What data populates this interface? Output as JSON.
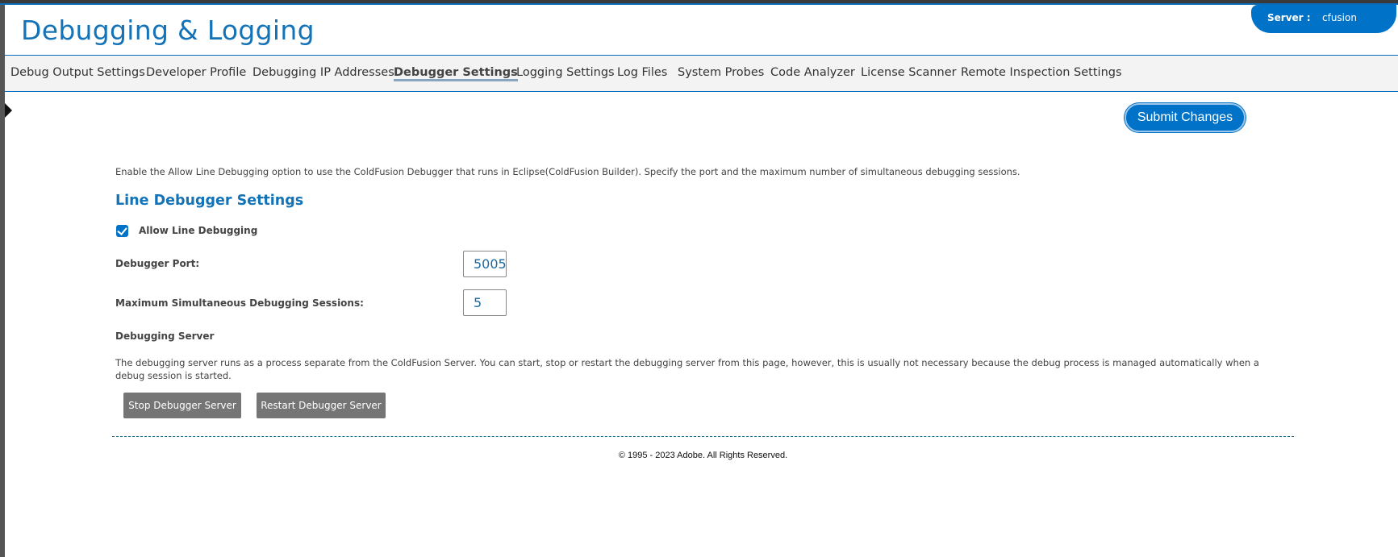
{
  "header": {
    "title": "Debugging & Logging",
    "server_label": "Server :",
    "server_value": "cfusion"
  },
  "nav": {
    "tabs": [
      {
        "label": "Debug Output Settings"
      },
      {
        "label": "Developer Profile"
      },
      {
        "label": "Debugging IP Addresses"
      },
      {
        "label": "Debugger Settings",
        "active": true
      },
      {
        "label": "Logging Settings"
      },
      {
        "label": "Log Files"
      },
      {
        "label": "System Probes"
      },
      {
        "label": "Code Analyzer"
      },
      {
        "label": "License Scanner"
      },
      {
        "label": "Remote Inspection Settings"
      }
    ]
  },
  "actions": {
    "submit_label": "Submit Changes"
  },
  "content": {
    "intro": "Enable the Allow Line Debugging option to use the ColdFusion Debugger that runs in Eclipse(ColdFusion Builder). Specify the port and the maximum number of simultaneous debugging sessions.",
    "section_title": "Line Debugger Settings",
    "allow_line_debugging": {
      "label": "Allow Line Debugging",
      "checked": true
    },
    "debugger_port": {
      "label": "Debugger Port:",
      "value": "5005"
    },
    "max_sessions": {
      "label": "Maximum Simultaneous Debugging Sessions:",
      "value": "5"
    },
    "debugging_server": {
      "heading": "Debugging Server",
      "description": "The debugging server runs as a process separate from the ColdFusion Server. You can start, stop or restart the debugging server from this page, however, this is usually not necessary because the debug process is managed automatically when a debug session is started.",
      "stop_label": "Stop Debugger Server",
      "restart_label": "Restart Debugger Server"
    }
  },
  "footer": {
    "copyright": "© 1995 - 2023 Adobe. All Rights Reserved."
  },
  "colors": {
    "accent": "#0073c9",
    "title": "#1473b6",
    "button_gray": "#757575"
  }
}
